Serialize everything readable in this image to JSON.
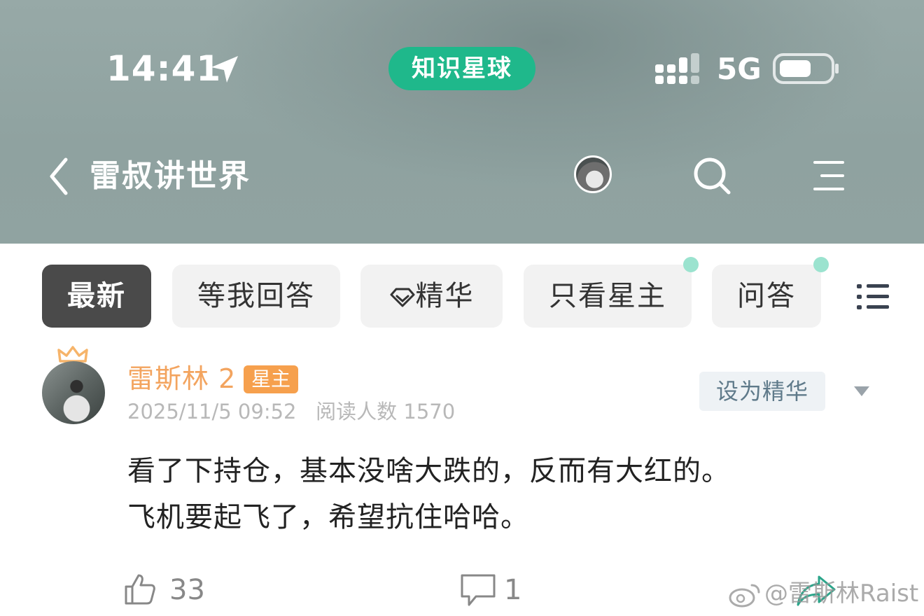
{
  "status_bar": {
    "time": "14:41",
    "app_name": "知识星球",
    "network": "5G"
  },
  "header": {
    "title": "雷叔讲世界"
  },
  "tabs": [
    {
      "label": "最新",
      "active": true
    },
    {
      "label": "等我回答"
    },
    {
      "label": "精华"
    },
    {
      "label": "只看星主",
      "has_dot": true
    },
    {
      "label": "问答",
      "has_dot": true
    }
  ],
  "post": {
    "author": "雷斯林 2",
    "badge": "星主",
    "date": "2025/11/5 09:52",
    "reads": "阅读人数 1570",
    "featured_button": "设为精华",
    "body_line1": "看了下持仓，基本没啥大跌的，反而有大红的。",
    "body_line2": "飞机要起飞了，希望抗住哈哈。",
    "likes": "33",
    "comments": "1"
  },
  "watermark": "@雷斯林Raist",
  "colors": {
    "accent": "#1fb88b",
    "author": "#f3a45f",
    "badge": "#f6a04d",
    "dot": "#9be3cf"
  }
}
